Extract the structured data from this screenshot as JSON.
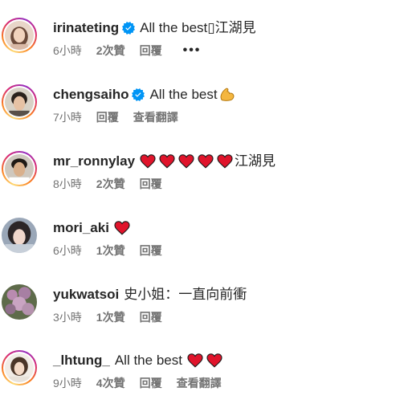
{
  "comments": [
    {
      "username": "irinateting",
      "verified": true,
      "text": "All the best▯江湖見",
      "time": "6小時",
      "likes": "2次贊",
      "reply": "回覆",
      "more": "•••"
    },
    {
      "username": "chengsaiho",
      "verified": true,
      "text": "All the best",
      "emoji": "flexed-biceps",
      "time": "7小時",
      "reply": "回覆",
      "translate": "查看翻譯"
    },
    {
      "username": "mr_ronnylay",
      "verified": false,
      "hearts": 5,
      "text": "江湖見",
      "time": "8小時",
      "likes": "2次贊",
      "reply": "回覆"
    },
    {
      "username": "mori_aki",
      "verified": false,
      "hearts": 1,
      "time": "6小時",
      "likes": "1次贊",
      "reply": "回覆"
    },
    {
      "username": "yukwatsoi",
      "verified": false,
      "text": "史小姐：一直向前衝",
      "time": "3小時",
      "likes": "1次贊",
      "reply": "回覆"
    },
    {
      "username": "_lhtung_",
      "verified": false,
      "text": "All the best",
      "hearts": 2,
      "time": "9小時",
      "likes": "4次贊",
      "reply": "回覆",
      "translate": "查看翻譯"
    }
  ],
  "icons": {
    "verified": "verified-badge-icon",
    "heart": "red-heart-icon",
    "muscle": "flexed-biceps-icon",
    "more": "more-options-icon"
  },
  "colors": {
    "text": "#262626",
    "secondary": "#737373",
    "verified": "#0095f6",
    "heart": "#e0142b"
  }
}
